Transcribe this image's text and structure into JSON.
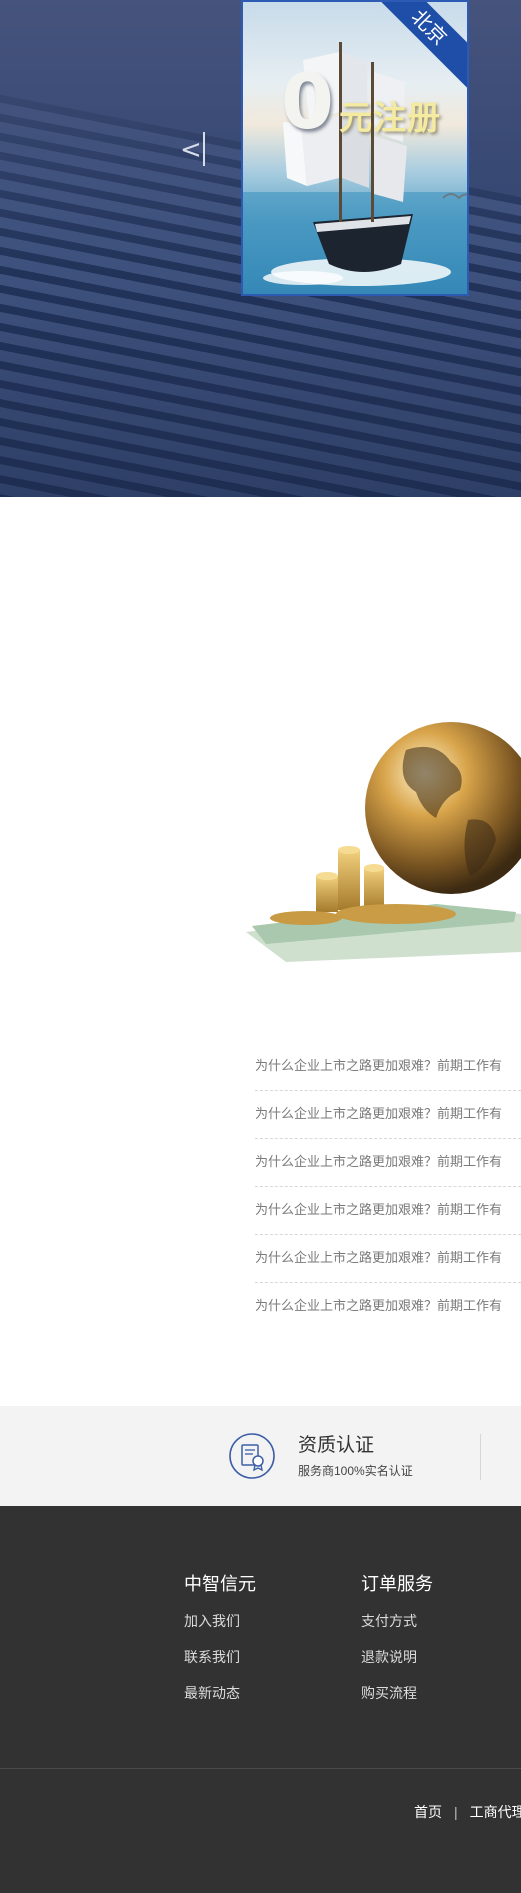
{
  "hero": {
    "prev_arrow": "<",
    "poster": {
      "digit": "0",
      "title": "元注册",
      "ribbon": "北京"
    }
  },
  "news": {
    "items": [
      "为什么企业上市之路更加艰难？前期工作有",
      "为什么企业上市之路更加艰难？前期工作有",
      "为什么企业上市之路更加艰难？前期工作有",
      "为什么企业上市之路更加艰难？前期工作有",
      "为什么企业上市之路更加艰难？前期工作有",
      "为什么企业上市之路更加艰难？前期工作有"
    ]
  },
  "qualification": {
    "icon": "certificate-icon",
    "title": "资质认证",
    "subtitle": "服务商100%实名认证",
    "accent_color": "#3c5fa8"
  },
  "footer": {
    "col1": {
      "title": "中智信元",
      "links": [
        "加入我们",
        "联系我们",
        "最新动态"
      ]
    },
    "col2": {
      "title": "订单服务",
      "links": [
        "支付方式",
        "退款说明",
        "购买流程"
      ]
    },
    "bottom_nav": {
      "home": "首页",
      "separator": "|",
      "agency": "工商代理"
    },
    "background_color": "#323232"
  }
}
